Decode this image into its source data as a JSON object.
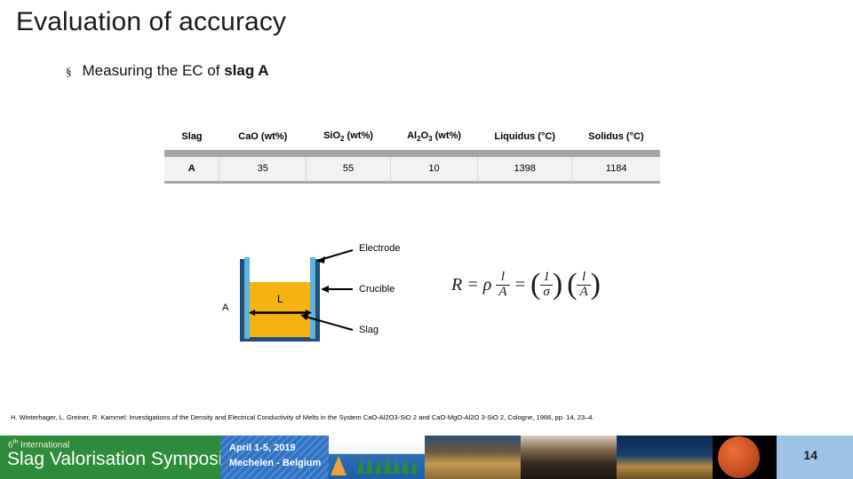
{
  "slide": {
    "title": "Evaluation of accuracy",
    "bullet_marker": "§",
    "bullet_text_plain": "Measuring the EC of slag A",
    "bullet_text_prefix": "Measuring the EC of ",
    "bullet_text_bold": "slag A"
  },
  "table": {
    "headers": [
      {
        "label": "Slag",
        "sub": ""
      },
      {
        "label": "CaO (wt%)",
        "sub": ""
      },
      {
        "label": "SiO",
        "sub": "2",
        "suffix": " (wt%)"
      },
      {
        "label": "Al",
        "sub": "2",
        "mid": "O",
        "sub2": "3",
        "suffix": " (wt%)"
      },
      {
        "label": "Liquidus (°C)",
        "sub": ""
      },
      {
        "label": "Solidus (°C)",
        "sub": ""
      }
    ],
    "header_plain": [
      "Slag",
      "CaO (wt%)",
      "SiO2 (wt%)",
      "Al2O3 (wt%)",
      "Liquidus (°C)",
      "Solidus (°C)"
    ],
    "rows": [
      {
        "slag": "A",
        "cao": "35",
        "sio2": "55",
        "al2o3": "10",
        "liquidus": "1398",
        "solidus": "1184"
      }
    ]
  },
  "diagram": {
    "title": "crucible-electrode-schematic",
    "label_area": "A",
    "label_length": "L",
    "callout_electrode": "Electrode",
    "callout_crucible": "Crucible",
    "callout_slag": "Slag",
    "colors": {
      "crucible_wall": "#1f4e79",
      "electrode": "#5fb3dd",
      "slag": "#f5b311"
    }
  },
  "formula": {
    "lhs": "R",
    "equals": "=",
    "rho": "ρ",
    "frac1_num": "l",
    "frac1_den": "A",
    "equals2": "=",
    "frac2_num": "1",
    "frac2_den": "σ",
    "frac3_num": "l",
    "frac3_den": "A",
    "plain": "R = ρ l/A = (1/σ)(l/A)"
  },
  "citation": {
    "text": "H. Winterhager, L. Greiner, R. Kammel: Investigations of the Density and Electrical Conductivity of Melts in the System CaO-Al2O3-SiO 2 and CaO-MgO-Al2O 3-SiO 2, Cologne, 1966, pp. 14, 23–4."
  },
  "footer": {
    "edition_small": "6",
    "edition_sup": "th",
    "edition_rest": " International",
    "edition_line": "6th International",
    "symposium_name": "Slag Valorisation Symposium",
    "date": "April 1-5, 2019",
    "location": "Mechelen - Belgium",
    "page_number": "14",
    "colors": {
      "green": "#2e8b3a",
      "blue": "#2f72c4",
      "page_strip": "#9dc3e6"
    }
  }
}
